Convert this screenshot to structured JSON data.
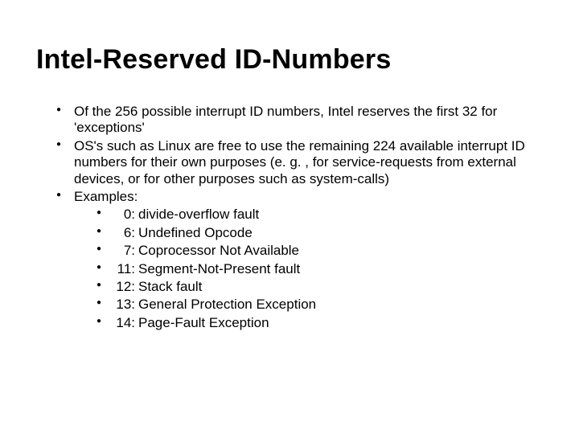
{
  "title": "Intel-Reserved ID-Numbers",
  "bullets": [
    "Of the 256 possible interrupt ID numbers, Intel reserves the first 32 for 'exceptions'",
    "OS's such as Linux are free to use the remaining 224 available interrupt ID numbers for their own purposes (e. g. , for service-requests from external devices, or for other purposes such as system-calls)",
    "Examples:"
  ],
  "examples": [
    {
      "num": "0:",
      "label": "divide-overflow fault"
    },
    {
      "num": "6:",
      "label": "Undefined Opcode"
    },
    {
      "num": "7:",
      "label": "Coprocessor Not Available"
    },
    {
      "num": "11:",
      "label": "Segment-Not-Present fault"
    },
    {
      "num": "12:",
      "label": "Stack fault"
    },
    {
      "num": "13:",
      "label": "General Protection Exception"
    },
    {
      "num": "14:",
      "label": "Page-Fault Exception"
    }
  ]
}
